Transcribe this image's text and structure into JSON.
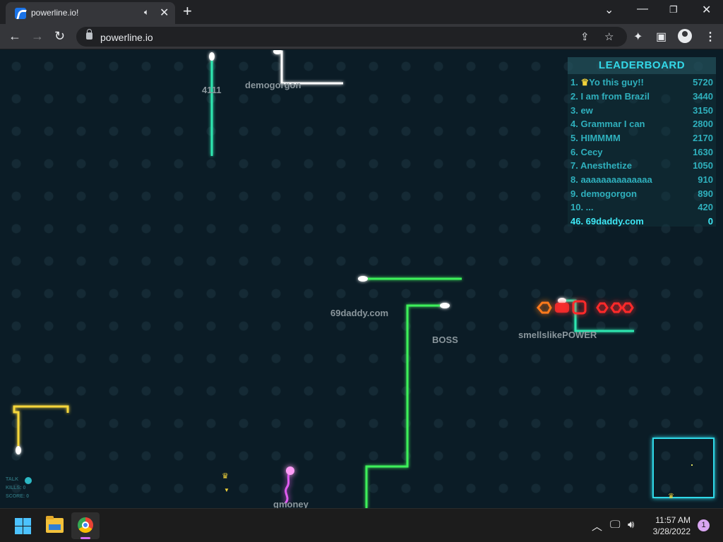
{
  "browser": {
    "tab_title": "powerline.io!",
    "url": "powerline.io",
    "icons": [
      "tab-favicon",
      "audio-icon",
      "close-icon",
      "new-tab-icon",
      "back-icon",
      "forward-icon",
      "reload-icon",
      "lock-icon",
      "share-icon",
      "star-icon",
      "extensions-icon",
      "side-panel-icon",
      "profile-icon",
      "menu-icon",
      "tab-search-icon",
      "minimize-icon",
      "restore-icon",
      "window-close-icon"
    ]
  },
  "game": {
    "leaderboard": {
      "title": "LEADERBOARD",
      "rows": [
        {
          "name": "1. 👑Yo this guy!!",
          "score": "5720"
        },
        {
          "name": "2. I am from Brazil",
          "score": "3440"
        },
        {
          "name": "3. ew",
          "score": "3150"
        },
        {
          "name": "4. Grammar I can",
          "score": "2800"
        },
        {
          "name": "5. HIMMMM",
          "score": "2170"
        },
        {
          "name": "6. Cecy",
          "score": "1630"
        },
        {
          "name": "7. Anesthetize",
          "score": "1050"
        },
        {
          "name": "8. aaaaaaaaaaaaaa",
          "score": "910"
        },
        {
          "name": "9. demogorgon",
          "score": "890"
        },
        {
          "name": "10. ...",
          "score": "420"
        }
      ],
      "me": {
        "name": "46. 69daddy.com",
        "score": "0"
      }
    },
    "players": {
      "p4111": "4111",
      "demogorgon": "demogorgon",
      "me": "69daddy.com",
      "boss": "BOSS",
      "smells": "smellslikePOWER",
      "gmoney": "gmoney"
    },
    "stats": {
      "talk": "TALK",
      "kills": "KILLS: 0",
      "score": "SCORE: 0"
    },
    "colors": {
      "teal": "#2ee6b0",
      "green": "#3ef05a",
      "white": "#ffffff",
      "yellow": "#f5d63a",
      "magenta": "#e05cf0",
      "cyan": "#2fd9e8",
      "red": "#ff2a2a",
      "orange": "#ff7a1a"
    }
  },
  "taskbar": {
    "time": "11:57 AM",
    "date": "3/28/2022",
    "notifications": "1",
    "icons": [
      "start-icon",
      "file-explorer-icon",
      "chrome-icon",
      "chevron-up-icon",
      "network-icon",
      "volume-icon"
    ]
  }
}
